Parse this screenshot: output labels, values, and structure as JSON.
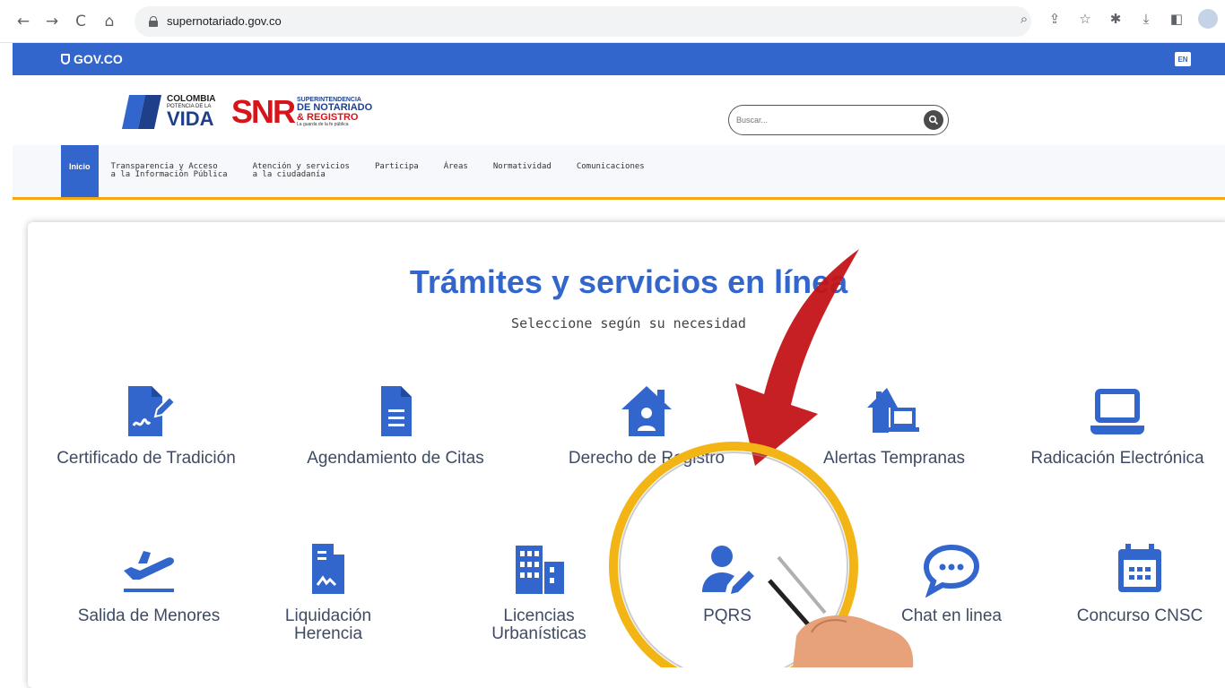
{
  "browser": {
    "url": "supernotariado.gov.co",
    "back_icon": "arrow-left-icon",
    "forward_icon": "arrow-right-icon",
    "reload_icon": "reload-icon",
    "home_icon": "home-icon"
  },
  "gov_bar": {
    "label": "GOV.CO",
    "lang": "EN",
    "color": "#3366cc"
  },
  "header": {
    "colombia_line1": "COLOMBIA",
    "colombia_line2": "POTENCIA DE LA",
    "colombia_line3": "VIDA",
    "snr_big": "SNR",
    "snr_line1": "SUPERINTENDENCIA",
    "snr_line2": "DE NOTARIADO",
    "snr_line3": "& REGISTRO",
    "snr_line4": "La guarda de la fe pública",
    "search_placeholder": "Buscar..."
  },
  "nav": {
    "items": [
      {
        "label": "Inicio"
      },
      {
        "label": "Transparencia y Acceso\na la Información Pública"
      },
      {
        "label": "Atención y servicios\na la ciudadanía"
      },
      {
        "label": "Participa"
      },
      {
        "label": "Áreas"
      },
      {
        "label": "Normatividad"
      },
      {
        "label": "Comunicaciones"
      }
    ],
    "accent": "#f3a712"
  },
  "services": {
    "title": "Trámites y servicios en línea",
    "subtitle": "Seleccione según su necesidad",
    "tiles": [
      {
        "label": "Certificado de Tradición",
        "icon": "document-signature-icon"
      },
      {
        "label": "Agendamiento de Citas",
        "icon": "file-text-icon"
      },
      {
        "label": "Derecho de Registro",
        "icon": "house-person-icon"
      },
      {
        "label": "Alertas Tempranas",
        "icon": "house-laptop-icon"
      },
      {
        "label": "Radicación Electrónica",
        "icon": "laptop-icon"
      },
      {
        "label": "Salida de Menores",
        "icon": "plane-departure-icon"
      },
      {
        "label": "Liquidación\nHerencia",
        "icon": "document-chart-icon"
      },
      {
        "label": "Licencias\nUrbanísticas",
        "icon": "buildings-icon"
      },
      {
        "label": "PQRS",
        "icon": "user-pen-icon"
      },
      {
        "label": "Chat en linea",
        "icon": "chat-bubble-icon"
      },
      {
        "label": "Concurso CNSC",
        "icon": "calendar-icon"
      }
    ]
  }
}
